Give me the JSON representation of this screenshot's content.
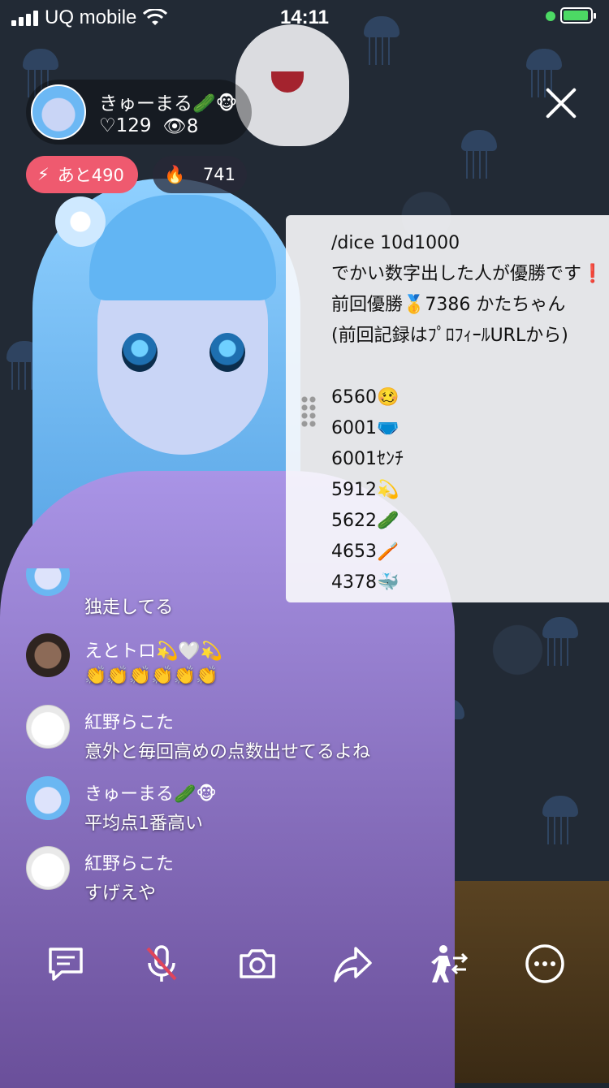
{
  "status_bar": {
    "carrier": "UQ mobile",
    "time": "14:11",
    "battery_level": 0.95,
    "accent_color": "#4cd964"
  },
  "host": {
    "name": "きゅーまる🥒🐵",
    "likes": "♡129",
    "viewers": "8"
  },
  "badges": {
    "remaining": "あと490",
    "fire_count": "741",
    "remaining_color": "#ef5a6f"
  },
  "panel": {
    "lines": [
      "/dice 10d1000",
      "でかい数字出した人が優勝です❗",
      "前回優勝🥇7386 かたちゃん",
      "(前回記録はﾌﾟﾛﾌｨｰﾙURLから)"
    ],
    "scores": [
      "6560🥴",
      "6001🩲",
      "6001ｾﾝﾁ",
      "5912💫",
      "5622🥒",
      "4653🪥",
      "4378🐳"
    ]
  },
  "chat": [
    {
      "name": "",
      "text": "独走してる",
      "avatar": "blue"
    },
    {
      "name": "えとトロ💫🤍💫",
      "text": "👏👏👏👏👏👏",
      "avatar": "dark"
    },
    {
      "name": "紅野らこた",
      "text": "意外と毎回高めの点数出せてるよね",
      "avatar": "sketch"
    },
    {
      "name": "きゅーまる🥒🐵",
      "text": "平均点1番高い",
      "avatar": "blue"
    },
    {
      "name": "紅野らこた",
      "text": "すげえや",
      "avatar": "sketch"
    }
  ],
  "toolbar": {
    "icons": [
      "comment-icon",
      "mic-muted-icon",
      "camera-icon",
      "share-icon",
      "collab-icon",
      "more-icon"
    ]
  }
}
